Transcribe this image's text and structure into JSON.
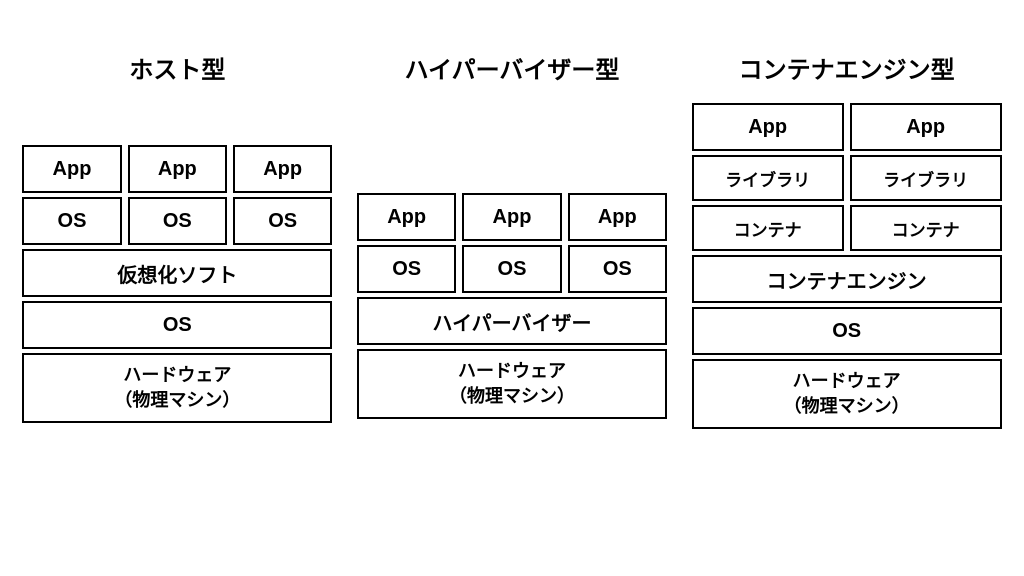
{
  "host": {
    "title": "ホスト型",
    "vms": [
      {
        "app": "App",
        "os": "OS"
      },
      {
        "app": "App",
        "os": "OS"
      },
      {
        "app": "App",
        "os": "OS"
      }
    ],
    "virt_soft": "仮想化ソフト",
    "os": "OS",
    "hw_line1": "ハードウェア",
    "hw_line2": "（物理マシン）"
  },
  "hyper": {
    "title": "ハイパーバイザー型",
    "vms": [
      {
        "app": "App",
        "os": "OS"
      },
      {
        "app": "App",
        "os": "OS"
      },
      {
        "app": "App",
        "os": "OS"
      }
    ],
    "hypervisor": "ハイパーバイザー",
    "hw_line1": "ハードウェア",
    "hw_line2": "（物理マシン）"
  },
  "container": {
    "title": "コンテナエンジン型",
    "pods": [
      {
        "app": "App",
        "lib": "ライブラリ",
        "ctr": "コンテナ"
      },
      {
        "app": "App",
        "lib": "ライブラリ",
        "ctr": "コンテナ"
      }
    ],
    "engine": "コンテナエンジン",
    "os": "OS",
    "hw_line1": "ハードウェア",
    "hw_line2": "（物理マシン）"
  }
}
